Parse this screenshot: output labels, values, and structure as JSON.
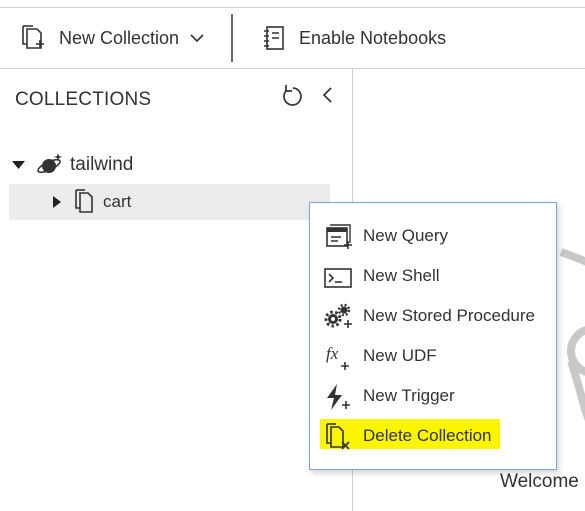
{
  "toolbar": {
    "new_collection_label": "New Collection",
    "enable_notebooks_label": "Enable Notebooks"
  },
  "sidebar": {
    "title": "COLLECTIONS",
    "database": {
      "name": "tailwind",
      "expanded": true
    },
    "collection": {
      "name": "cart",
      "expanded": false,
      "selected": true
    }
  },
  "context_menu": {
    "items": [
      {
        "label": "New Query",
        "icon": "new-query-icon"
      },
      {
        "label": "New Shell",
        "icon": "new-shell-icon"
      },
      {
        "label": "New Stored Procedure",
        "icon": "new-stored-procedure-icon"
      },
      {
        "label": "New UDF",
        "icon": "new-udf-icon"
      },
      {
        "label": "New Trigger",
        "icon": "new-trigger-icon"
      },
      {
        "label": "Delete Collection",
        "icon": "delete-collection-icon",
        "highlighted": true
      }
    ]
  },
  "main": {
    "welcome_text": "Welcome"
  },
  "colors": {
    "highlight": "#fbf500",
    "menu_border": "#7ea7d8",
    "selected_row": "#ececec"
  }
}
